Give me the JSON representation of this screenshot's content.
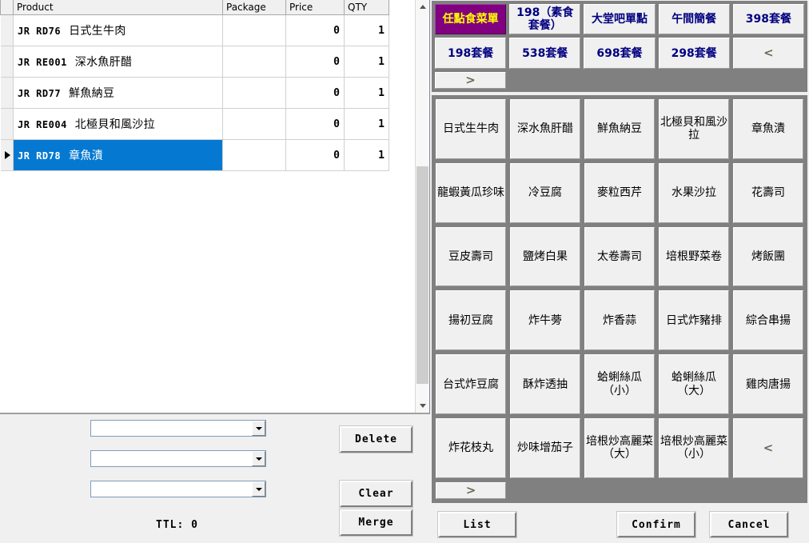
{
  "order_grid": {
    "columns": [
      "Product",
      "Package",
      "Price",
      "QTY"
    ],
    "rows": [
      {
        "code": "JR RD76",
        "name": "日式生牛肉",
        "package": "",
        "price": "0",
        "qty": "1",
        "selected": false
      },
      {
        "code": "JR RE001",
        "name": "深水魚肝醋",
        "package": "",
        "price": "0",
        "qty": "1",
        "selected": false
      },
      {
        "code": "JR RD77",
        "name": "鮮魚納豆",
        "package": "",
        "price": "0",
        "qty": "1",
        "selected": false
      },
      {
        "code": "JR RE004",
        "name": "北極貝和風沙拉",
        "package": "",
        "price": "0",
        "qty": "1",
        "selected": false
      },
      {
        "code": "JR RD78",
        "name": "章魚漬",
        "package": "",
        "price": "0",
        "qty": "1",
        "selected": true
      }
    ]
  },
  "controls": {
    "combo1_value": "",
    "combo2_value": "",
    "combo3_value": "",
    "total_label": "TTL: 0",
    "delete_label": "Delete",
    "clear_label": "Clear",
    "merge_label": "Merge"
  },
  "categories": [
    {
      "label": "任點食菜單",
      "active": true
    },
    {
      "label": "198（素食套餐）",
      "active": false
    },
    {
      "label": "大堂吧單點",
      "active": false
    },
    {
      "label": "午間簡餐",
      "active": false
    },
    {
      "label": "398套餐",
      "active": false
    },
    {
      "label": "198套餐",
      "active": false
    },
    {
      "label": "538套餐",
      "active": false
    },
    {
      "label": "698套餐",
      "active": false
    },
    {
      "label": "298套餐",
      "active": false
    },
    {
      "label": "<",
      "active": false,
      "nav": true
    },
    {
      "label": ">",
      "active": false,
      "nav": true
    }
  ],
  "products": [
    {
      "label": "日式生牛肉"
    },
    {
      "label": "深水魚肝醋"
    },
    {
      "label": "鮮魚納豆"
    },
    {
      "label": "北極貝和風沙拉"
    },
    {
      "label": "章魚漬"
    },
    {
      "label": "龍蝦黃瓜珍味"
    },
    {
      "label": "冷豆腐"
    },
    {
      "label": "麥粒西芹"
    },
    {
      "label": "水果沙拉"
    },
    {
      "label": "花壽司"
    },
    {
      "label": "豆皮壽司"
    },
    {
      "label": "鹽烤白果"
    },
    {
      "label": "太卷壽司"
    },
    {
      "label": "培根野菜卷"
    },
    {
      "label": "烤飯團"
    },
    {
      "label": "揚初豆腐"
    },
    {
      "label": "炸牛蒡"
    },
    {
      "label": "炸香蒜"
    },
    {
      "label": "日式炸豬排"
    },
    {
      "label": "綜合串揚"
    },
    {
      "label": "台式炸豆腐"
    },
    {
      "label": "酥炸透抽"
    },
    {
      "label": "蛤蜊絲瓜（小）"
    },
    {
      "label": "蛤蜊絲瓜（大）"
    },
    {
      "label": "雞肉唐揚"
    },
    {
      "label": "炸花枝丸"
    },
    {
      "label": "炒味增茄子"
    },
    {
      "label": "培根炒高麗菜（大）"
    },
    {
      "label": "培根炒高麗菜（小）"
    },
    {
      "label": "<",
      "nav": true
    },
    {
      "label": ">",
      "nav": true
    }
  ],
  "bottom_bar": {
    "list_label": "List",
    "confirm_label": "Confirm",
    "cancel_label": "Cancel"
  },
  "colors": {
    "selection_blue": "#0579d2",
    "active_category_bg": "#800080",
    "active_category_text": "#ffff00",
    "category_text": "#000080",
    "panel_gray": "#808080",
    "button_face": "#f0f0f0"
  }
}
